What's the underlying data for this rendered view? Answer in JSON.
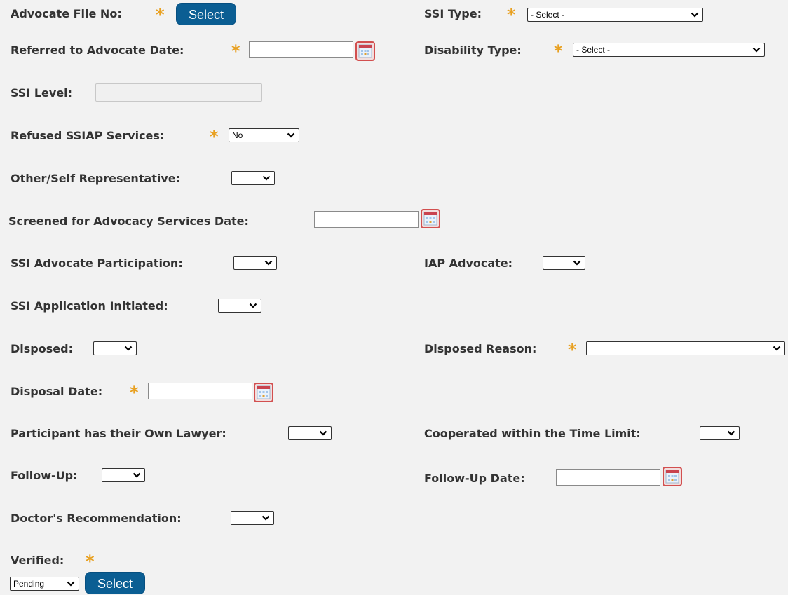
{
  "form": {
    "advocate_file_no": {
      "label": "Advocate File No:",
      "required_mark": "*",
      "button_label": "Select"
    },
    "ssi_type": {
      "label": "SSI Type:",
      "required_mark": "*",
      "value": "- Select -"
    },
    "referred_date": {
      "label": "Referred to Advocate Date:",
      "required_mark": "*",
      "value": ""
    },
    "disability_type": {
      "label": "Disability Type:",
      "required_mark": "*",
      "value": "- Select -"
    },
    "ssi_level": {
      "label": "SSI Level:",
      "value": ""
    },
    "refused_services": {
      "label": "Refused SSIAP Services:",
      "required_mark": "*",
      "value": "No"
    },
    "other_self_rep": {
      "label": "Other/Self Representative:",
      "value": ""
    },
    "screened_date": {
      "label": "Screened for Advocacy Services Date:",
      "value": ""
    },
    "advocate_participation": {
      "label": "SSI Advocate Participation:",
      "value": ""
    },
    "iap_advocate": {
      "label": "IAP Advocate:",
      "value": ""
    },
    "application_initiated": {
      "label": "SSI Application Initiated:",
      "value": ""
    },
    "disposed": {
      "label": "Disposed:",
      "value": ""
    },
    "disposed_reason": {
      "label": "Disposed Reason:",
      "required_mark": "*",
      "value": ""
    },
    "disposal_date": {
      "label": "Disposal Date:",
      "required_mark": "*",
      "value": ""
    },
    "own_lawyer": {
      "label": "Participant has their Own Lawyer:",
      "value": ""
    },
    "cooperated": {
      "label": "Cooperated within the Time Limit:",
      "value": ""
    },
    "follow_up": {
      "label": "Follow-Up:",
      "value": ""
    },
    "follow_up_date": {
      "label": "Follow-Up Date:",
      "value": ""
    },
    "doctor_rec": {
      "label": "Doctor's Recommendation:",
      "value": ""
    },
    "verified": {
      "label": "Verified:",
      "required_mark": "*",
      "value": "Pending",
      "button_label": "Select"
    }
  },
  "colors": {
    "background": "#f2f2f2",
    "label_text": "#333333",
    "required_asterisk": "#e8a020",
    "button_bg": "#0b5e93",
    "calendar_border": "#d24f4f"
  },
  "icons": {
    "calendar": "calendar-icon",
    "dropdown": "chevron-down-icon"
  }
}
